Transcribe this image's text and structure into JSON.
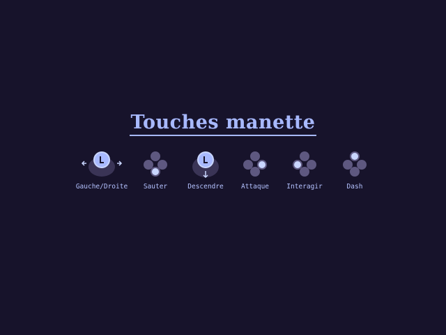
{
  "title": "Touches manette",
  "controls": [
    {
      "label": "Gauche/Droite",
      "icon": "left-stick-horizontal-icon"
    },
    {
      "label": "Sauter",
      "icon": "face-buttons-bottom-icon"
    },
    {
      "label": "Descendre",
      "icon": "left-stick-down-icon"
    },
    {
      "label": "Attaque",
      "icon": "face-buttons-right-icon"
    },
    {
      "label": "Interagir",
      "icon": "face-buttons-left-icon"
    },
    {
      "label": "Dash",
      "icon": "face-buttons-top-icon"
    }
  ],
  "colors": {
    "background": "#17132b",
    "text": "#b4c2ff",
    "button_idle": "#5e5880",
    "button_active": "#c9d6ff",
    "stick_base": "#3a3456"
  }
}
